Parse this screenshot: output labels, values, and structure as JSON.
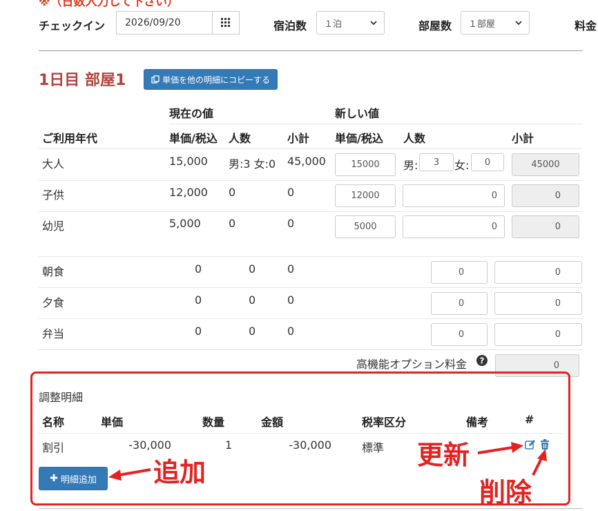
{
  "header": {
    "top_cut_text": "※（日数入力して下さい）",
    "checkin_label": "チェックイン",
    "checkin_date": "2026/09/20",
    "nights_label": "宿泊数",
    "nights_value": "１泊",
    "rooms_label": "部屋数",
    "rooms_value": "１部屋",
    "price_label": "料金"
  },
  "section": {
    "title": "1日目 部屋1",
    "copy_button": "単価を他の明細にコピーする"
  },
  "table_headers": {
    "current": "現在の値",
    "new": "新しい値",
    "age_group": "ご利用年代",
    "cur_unit": "単価/税込",
    "cur_count": "人数",
    "cur_subtotal": "小計",
    "new_unit": "単価/税込",
    "new_count": "人数",
    "new_subtotal": "小計"
  },
  "age_rows": [
    {
      "name": "大人",
      "cur_unit": "15,000",
      "cur_count": "男:3 女:0",
      "cur_subtotal": "45,000",
      "new_unit": "15000",
      "male_label": "男:",
      "male": "3",
      "female_label": "女:",
      "female": "0",
      "new_subtotal": "45000"
    },
    {
      "name": "子供",
      "cur_unit": "12,000",
      "cur_count": "0",
      "cur_subtotal": "0",
      "new_unit": "12000",
      "new_count": "0",
      "new_subtotal": "0"
    },
    {
      "name": "幼児",
      "cur_unit": "5,000",
      "cur_count": "0",
      "cur_subtotal": "0",
      "new_unit": "5000",
      "new_count": "0",
      "new_subtotal": "0"
    }
  ],
  "meal_rows": [
    {
      "name": "朝食",
      "a": "0",
      "b": "0",
      "c": "0",
      "count": "0",
      "subtotal": "0"
    },
    {
      "name": "夕食",
      "a": "0",
      "b": "0",
      "c": "0",
      "count": "0",
      "subtotal": "0"
    },
    {
      "name": "弁当",
      "a": "0",
      "b": "0",
      "c": "0",
      "count": "0",
      "subtotal": "0"
    }
  ],
  "option_fee": {
    "label": "高機能オプション料金",
    "value": "0"
  },
  "adjustment": {
    "title": "調整明細",
    "headers": {
      "name": "名称",
      "unit": "単価",
      "qty": "数量",
      "amount": "金額",
      "tax": "税率区分",
      "note": "備考",
      "num": "#"
    },
    "row": {
      "name": "割引",
      "unit": "-30,000",
      "qty": "1",
      "amount": "-30,000",
      "tax": "標準",
      "note": ""
    },
    "add_button": "明細追加"
  },
  "annotations": {
    "update": "更新",
    "add": "追加",
    "delete": "削除"
  },
  "colors": {
    "accent": "#337ab7",
    "title": "#b1433b",
    "annotation": "#e32222"
  }
}
